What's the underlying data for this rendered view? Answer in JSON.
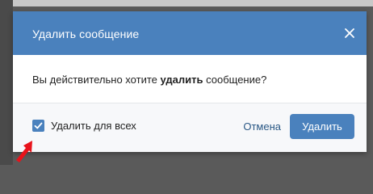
{
  "dialog": {
    "title": "Удалить сообщение",
    "message_before": "Вы действительно хотите ",
    "message_bold": "удалить",
    "message_after": " сообщение?",
    "checkbox_label": "Удалить для всех",
    "checkbox_checked": true,
    "cancel_label": "Отмена",
    "delete_label": "Удалить"
  },
  "icons": {
    "close": "close-icon",
    "checkmark": "checkmark-icon",
    "annotation_arrow": "red-arrow"
  },
  "colors": {
    "header": "#4a81bd",
    "primary_button": "#4a81bd",
    "link": "#2a5885",
    "footer": "#f7f8fa",
    "arrow": "#e8131b"
  }
}
